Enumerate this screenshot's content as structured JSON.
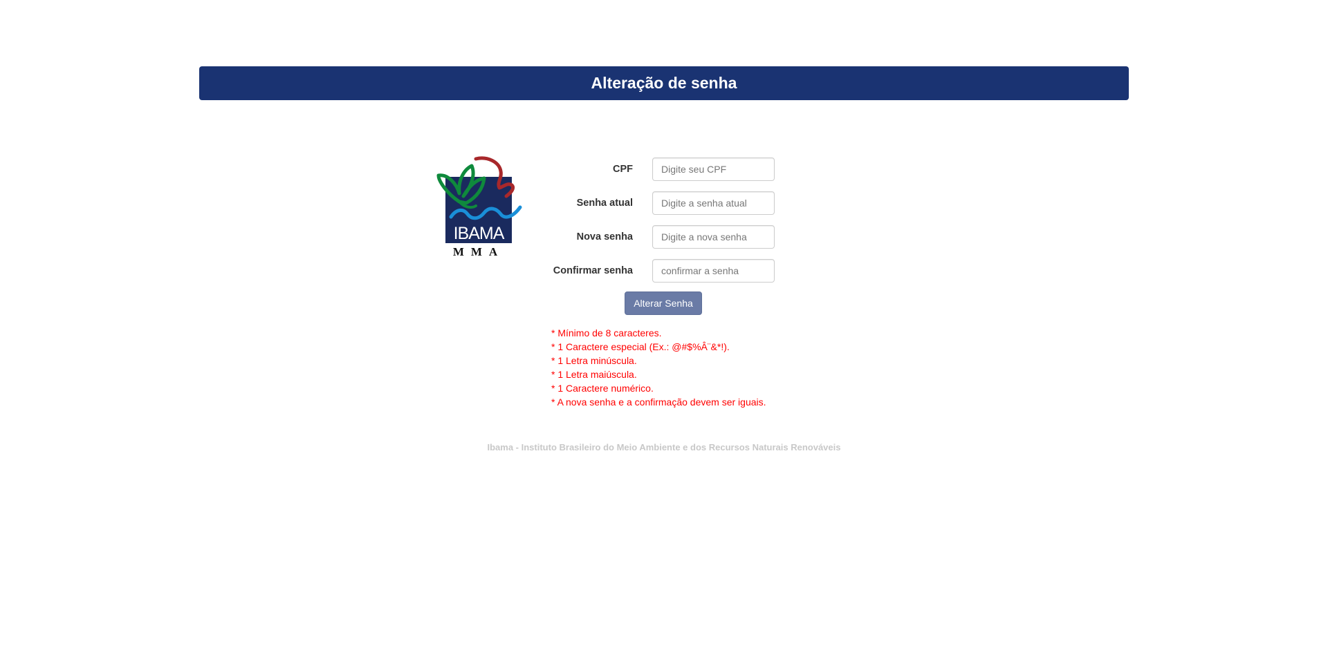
{
  "header": {
    "title": "Alteração de senha"
  },
  "logo": {
    "name": "IBAMA",
    "subtitle": "MMA"
  },
  "form": {
    "fields": [
      {
        "label": "CPF",
        "placeholder": "Digite seu CPF",
        "value": ""
      },
      {
        "label": "Senha atual",
        "placeholder": "Digite a senha atual",
        "value": ""
      },
      {
        "label": "Nova senha",
        "placeholder": "Digite a nova senha",
        "value": ""
      },
      {
        "label": "Confirmar senha",
        "placeholder": "confirmar a senha",
        "value": ""
      }
    ],
    "submit_label": "Alterar Senha"
  },
  "rules": [
    "* Mínimo de 8 caracteres.",
    "* 1 Caractere especial (Ex.: @#$%Â¨&*!).",
    "* 1 Letra minúscula.",
    "* 1 Letra maiúscula.",
    "* 1 Caractere numérico.",
    "* A nova senha e a confirmação devem ser iguais."
  ],
  "footer": {
    "text": "Ibama - Instituto Brasileiro do Meio Ambiente e dos Recursos Naturais Renováveis"
  },
  "colors": {
    "header_bg": "#1a3372",
    "button_bg": "#6a7ba6",
    "rule_text": "#ff0000",
    "footer_text": "#c8c8c8",
    "logo_navy": "#1a2a5e",
    "logo_green": "#0f8a3c",
    "logo_red": "#a8282b",
    "logo_blue": "#1a8fd8"
  }
}
